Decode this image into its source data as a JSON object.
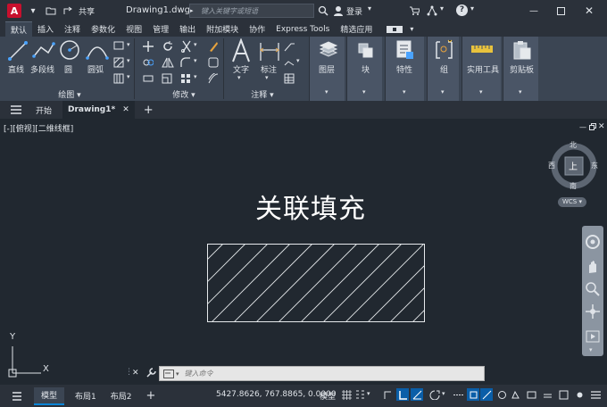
{
  "titlebar": {
    "logo": "A",
    "share": "共享",
    "doc_name": "Drawing1.dwg",
    "search_placeholder": "键入关键字或短语",
    "login": "登录",
    "colors": {
      "logo": "#c8102e"
    }
  },
  "ribbon_tabs": [
    "默认",
    "插入",
    "注释",
    "参数化",
    "视图",
    "管理",
    "输出",
    "附加模块",
    "协作",
    "Express Tools",
    "精选应用"
  ],
  "ribbon": {
    "draw": {
      "items": [
        "直线",
        "多段线",
        "圆",
        "圆弧"
      ],
      "group": "绘图"
    },
    "modify": {
      "group": "修改"
    },
    "annotate": {
      "items": [
        "文字",
        "标注"
      ],
      "group": "注释"
    },
    "panels": [
      "图层",
      "块",
      "特性",
      "组",
      "实用工具",
      "剪贴板"
    ]
  },
  "file_tabs": {
    "start": "开始",
    "drawing": "Drawing1*"
  },
  "canvas": {
    "view_label": "[-][俯视][二维线框]",
    "title": "关联填充",
    "viewcube": {
      "top": "上",
      "n": "北",
      "s": "南",
      "e": "东",
      "w": "西",
      "wcs": "WCS"
    },
    "ucs": {
      "x": "X",
      "y": "Y"
    }
  },
  "cmdline": {
    "placeholder": "键入命令"
  },
  "statusbar": {
    "tabs": [
      "模型",
      "布局1",
      "布局2"
    ],
    "coords": "5427.8626, 767.8865, 0.0000",
    "model": "模型"
  }
}
